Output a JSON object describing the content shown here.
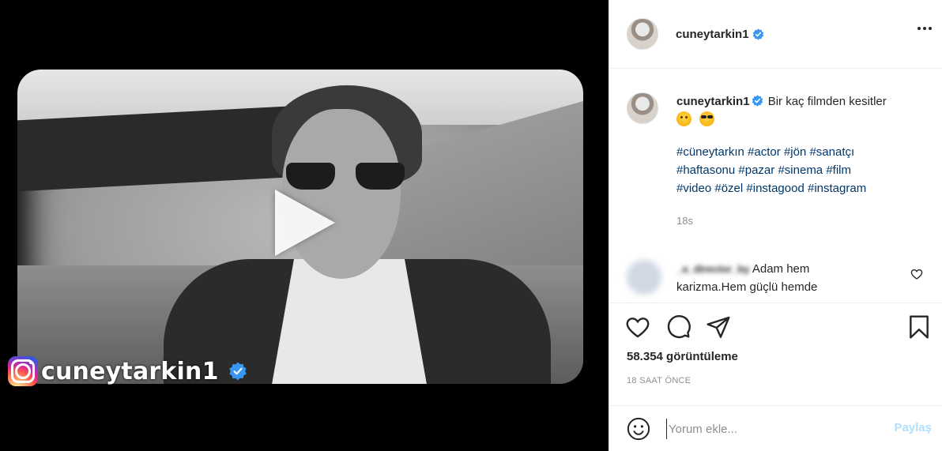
{
  "video": {
    "watermark_username": "cuneytarkin1",
    "watermark_icons": [
      "instagram-logo-icon",
      "verified-badge-icon"
    ],
    "play_icon": "play-icon"
  },
  "header": {
    "username": "cuneytarkin1",
    "verified_icon": "verified-badge-icon",
    "more_icon": "more-options-icon"
  },
  "caption": {
    "username": "cuneytarkin1",
    "text": "Bir kaç filmden kesitler",
    "emojis": [
      "slightly-smiling-face-emoji",
      "smiling-face-with-sunglasses-emoji"
    ],
    "hashtags": [
      "#cüneytarkın",
      "#actor",
      "#jön",
      "#sanatçı",
      "#haftasonu",
      "#pazar",
      "#sinema",
      "#film",
      "#video",
      "#özel",
      "#instagood",
      "#instagram"
    ],
    "time": "18s"
  },
  "comment": {
    "username": "_a_director_by",
    "text": "Adam hem karizma.Hem güçlü hemde"
  },
  "actions": {
    "like_icon": "heart-icon",
    "comment_icon": "comment-bubble-icon",
    "share_icon": "paper-plane-icon",
    "save_icon": "bookmark-icon"
  },
  "stats": {
    "views": "58.354 görüntüleme",
    "date": "18 SAAT ÖNCE"
  },
  "add_comment": {
    "placeholder": "Yorum ekle...",
    "post_label": "Paylaş"
  },
  "colors": {
    "link": "#00376b",
    "verified": "#3897f0",
    "muted": "#8e8e8e",
    "post_disabled": "#b2dffc"
  }
}
